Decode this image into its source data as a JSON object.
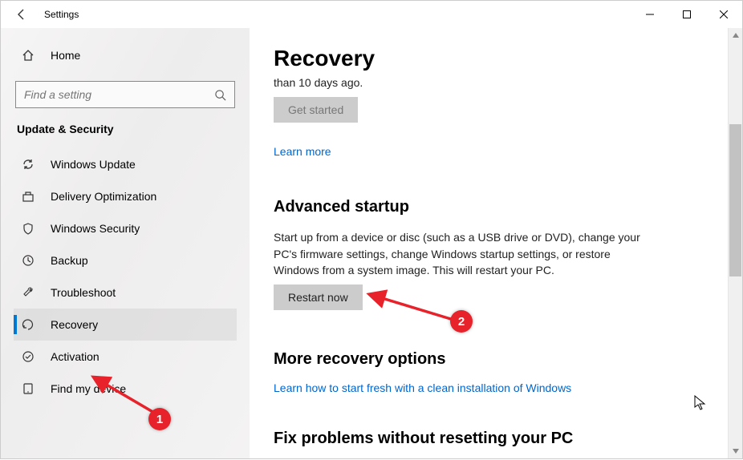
{
  "window": {
    "title": "Settings",
    "controls": {
      "min": "—",
      "max": "☐",
      "close": "✕"
    }
  },
  "sidebar": {
    "home_label": "Home",
    "search_placeholder": "Find a setting",
    "section_label": "Update & Security",
    "items": [
      {
        "label": "Windows Update",
        "icon": "sync-icon"
      },
      {
        "label": "Delivery Optimization",
        "icon": "delivery-icon"
      },
      {
        "label": "Windows Security",
        "icon": "shield-icon"
      },
      {
        "label": "Backup",
        "icon": "backup-icon"
      },
      {
        "label": "Troubleshoot",
        "icon": "troubleshoot-icon"
      },
      {
        "label": "Recovery",
        "icon": "recovery-icon",
        "active": true
      },
      {
        "label": "Activation",
        "icon": "activation-icon"
      },
      {
        "label": "Find my device",
        "icon": "find-device-icon"
      }
    ]
  },
  "content": {
    "page_title": "Recovery",
    "truncated_line": "than 10 days ago.",
    "get_started_label": "Get started",
    "learn_more_label": "Learn more",
    "advanced_heading": "Advanced startup",
    "advanced_text": "Start up from a device or disc (such as a USB drive or DVD), change your PC's firmware settings, change Windows startup settings, or restore Windows from a system image. This will restart your PC.",
    "restart_label": "Restart now",
    "more_heading": "More recovery options",
    "fresh_link": "Learn how to start fresh with a clean installation of Windows",
    "fix_heading": "Fix problems without resetting your PC"
  },
  "annotations": {
    "badges": [
      "1",
      "2"
    ]
  }
}
